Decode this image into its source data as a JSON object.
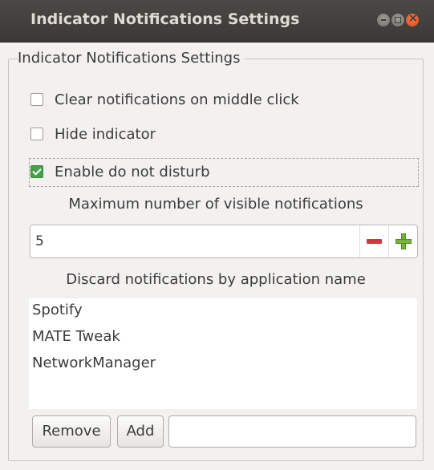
{
  "window": {
    "title": "Indicator Notifications Settings",
    "controls": [
      "minimize",
      "maximize",
      "close"
    ]
  },
  "frame": {
    "label": "Indicator Notifications Settings"
  },
  "options": {
    "clear_on_middle_click": {
      "label": "Clear notifications on middle click",
      "checked": false
    },
    "hide_indicator": {
      "label": "Hide indicator",
      "checked": false
    },
    "do_not_disturb": {
      "label": "Enable do not disturb",
      "checked": true
    }
  },
  "max_visible": {
    "label": "Maximum number of visible notifications",
    "value": "5"
  },
  "blacklist": {
    "label": "Discard notifications by application name",
    "items": [
      "Spotify",
      "MATE Tweak",
      "NetworkManager"
    ],
    "remove_label": "Remove",
    "add_label": "Add",
    "entry_value": ""
  },
  "colors": {
    "titlebar": "#3c3b37",
    "window_bg": "#f2f1f0",
    "check_green": "#48a04a",
    "minus_red": "#d6333a",
    "plus_green": "#76b43a",
    "close_orange": "#df4a16"
  }
}
